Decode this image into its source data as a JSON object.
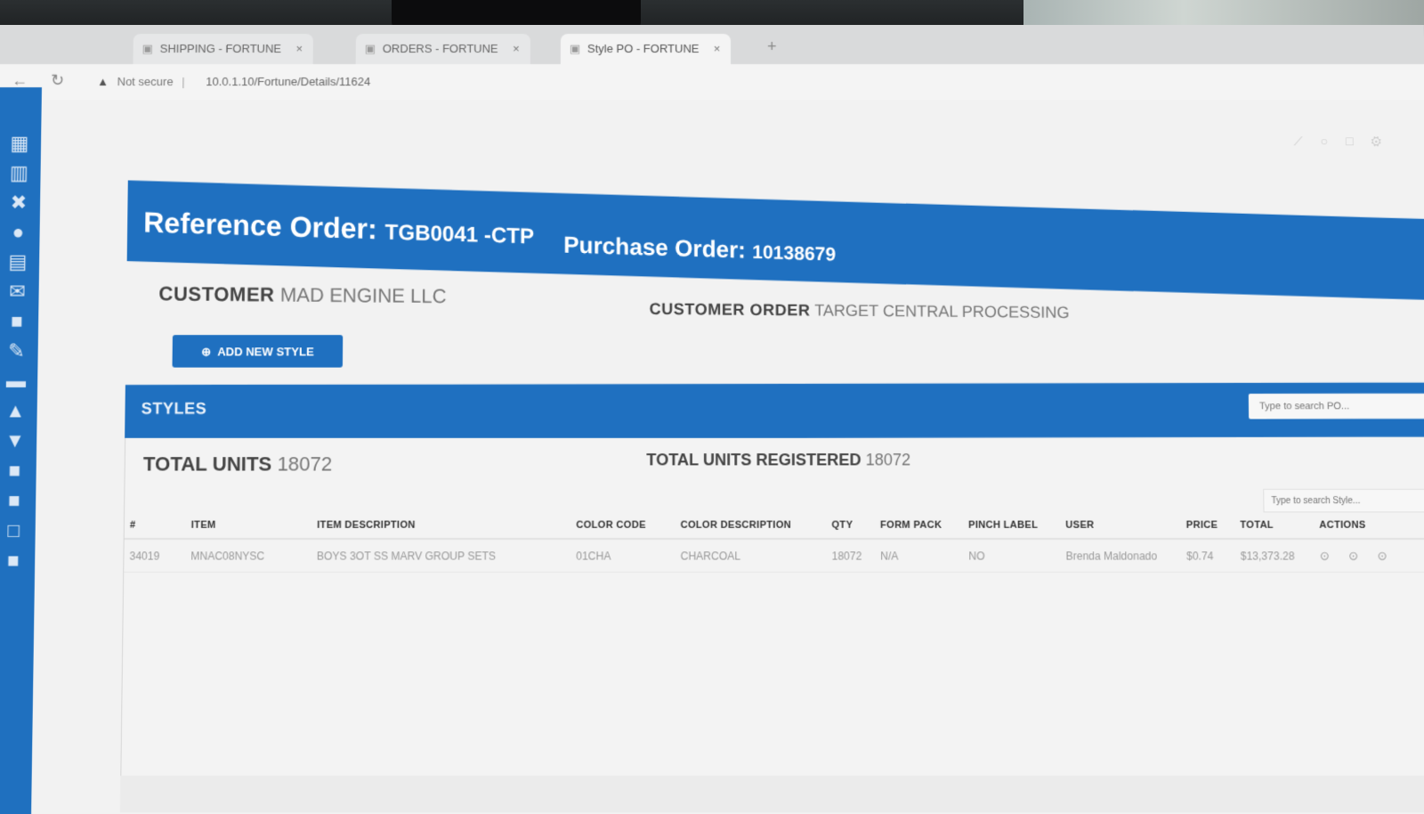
{
  "browser": {
    "tabs": [
      {
        "label": "SHIPPING - FORTUNE"
      },
      {
        "label": "ORDERS - FORTUNE"
      },
      {
        "label": "Style PO - FORTUNE"
      }
    ],
    "security_text": "Not secure",
    "url": "10.0.1.10/Fortune/Details/11624"
  },
  "header": {
    "reference_label": "Reference Order:",
    "reference_value": "TGB0041 -CTP",
    "po_label": "Purchase Order:",
    "po_value": "10138679"
  },
  "customer": {
    "label": "CUSTOMER",
    "value": "MAD ENGINE LLC",
    "order_label": "CUSTOMER ORDER",
    "order_value": "TARGET CENTRAL PROCESSING"
  },
  "add_style_label": "ADD NEW STYLE",
  "styles": {
    "title": "STYLES",
    "search_placeholder": "Type to search PO...",
    "total_units_label": "TOTAL UNITS",
    "total_units_value": "18072",
    "total_registered_label": "TOTAL UNITS REGISTERED",
    "total_registered_value": "18072",
    "table_search_placeholder": "Type to search Style..."
  },
  "table": {
    "columns": [
      "#",
      "ITEM",
      "ITEM DESCRIPTION",
      "COLOR CODE",
      "COLOR DESCRIPTION",
      "QTY",
      "FORM PACK",
      "PINCH LABEL",
      "USER",
      "PRICE",
      "TOTAL",
      "ACTIONS"
    ],
    "rows": [
      {
        "num": "34019",
        "item": "MNAC08NYSC",
        "description": "BOYS 3OT SS MARV GROUP SETS",
        "color_code": "01CHA",
        "color_description": "CHARCOAL",
        "qty": "18072",
        "form_pack": "N/A",
        "pinch_label": "NO",
        "user": "Brenda Maldonado",
        "price": "$0.74",
        "total": "$13,373.28"
      }
    ]
  },
  "sidebar": {
    "icons": [
      "dashboard-icon",
      "calendar-icon",
      "tools-icon",
      "drop-icon",
      "list-icon",
      "mail-icon",
      "file-icon",
      "brush-icon",
      "truck-icon",
      "box-icon",
      "shirt-icon",
      "folder-icon",
      "folder-icon",
      "window-icon",
      "folder-icon"
    ]
  },
  "colors": {
    "brand_blue": "#1f70c0",
    "sidebar_blue": "#1f70bf"
  }
}
